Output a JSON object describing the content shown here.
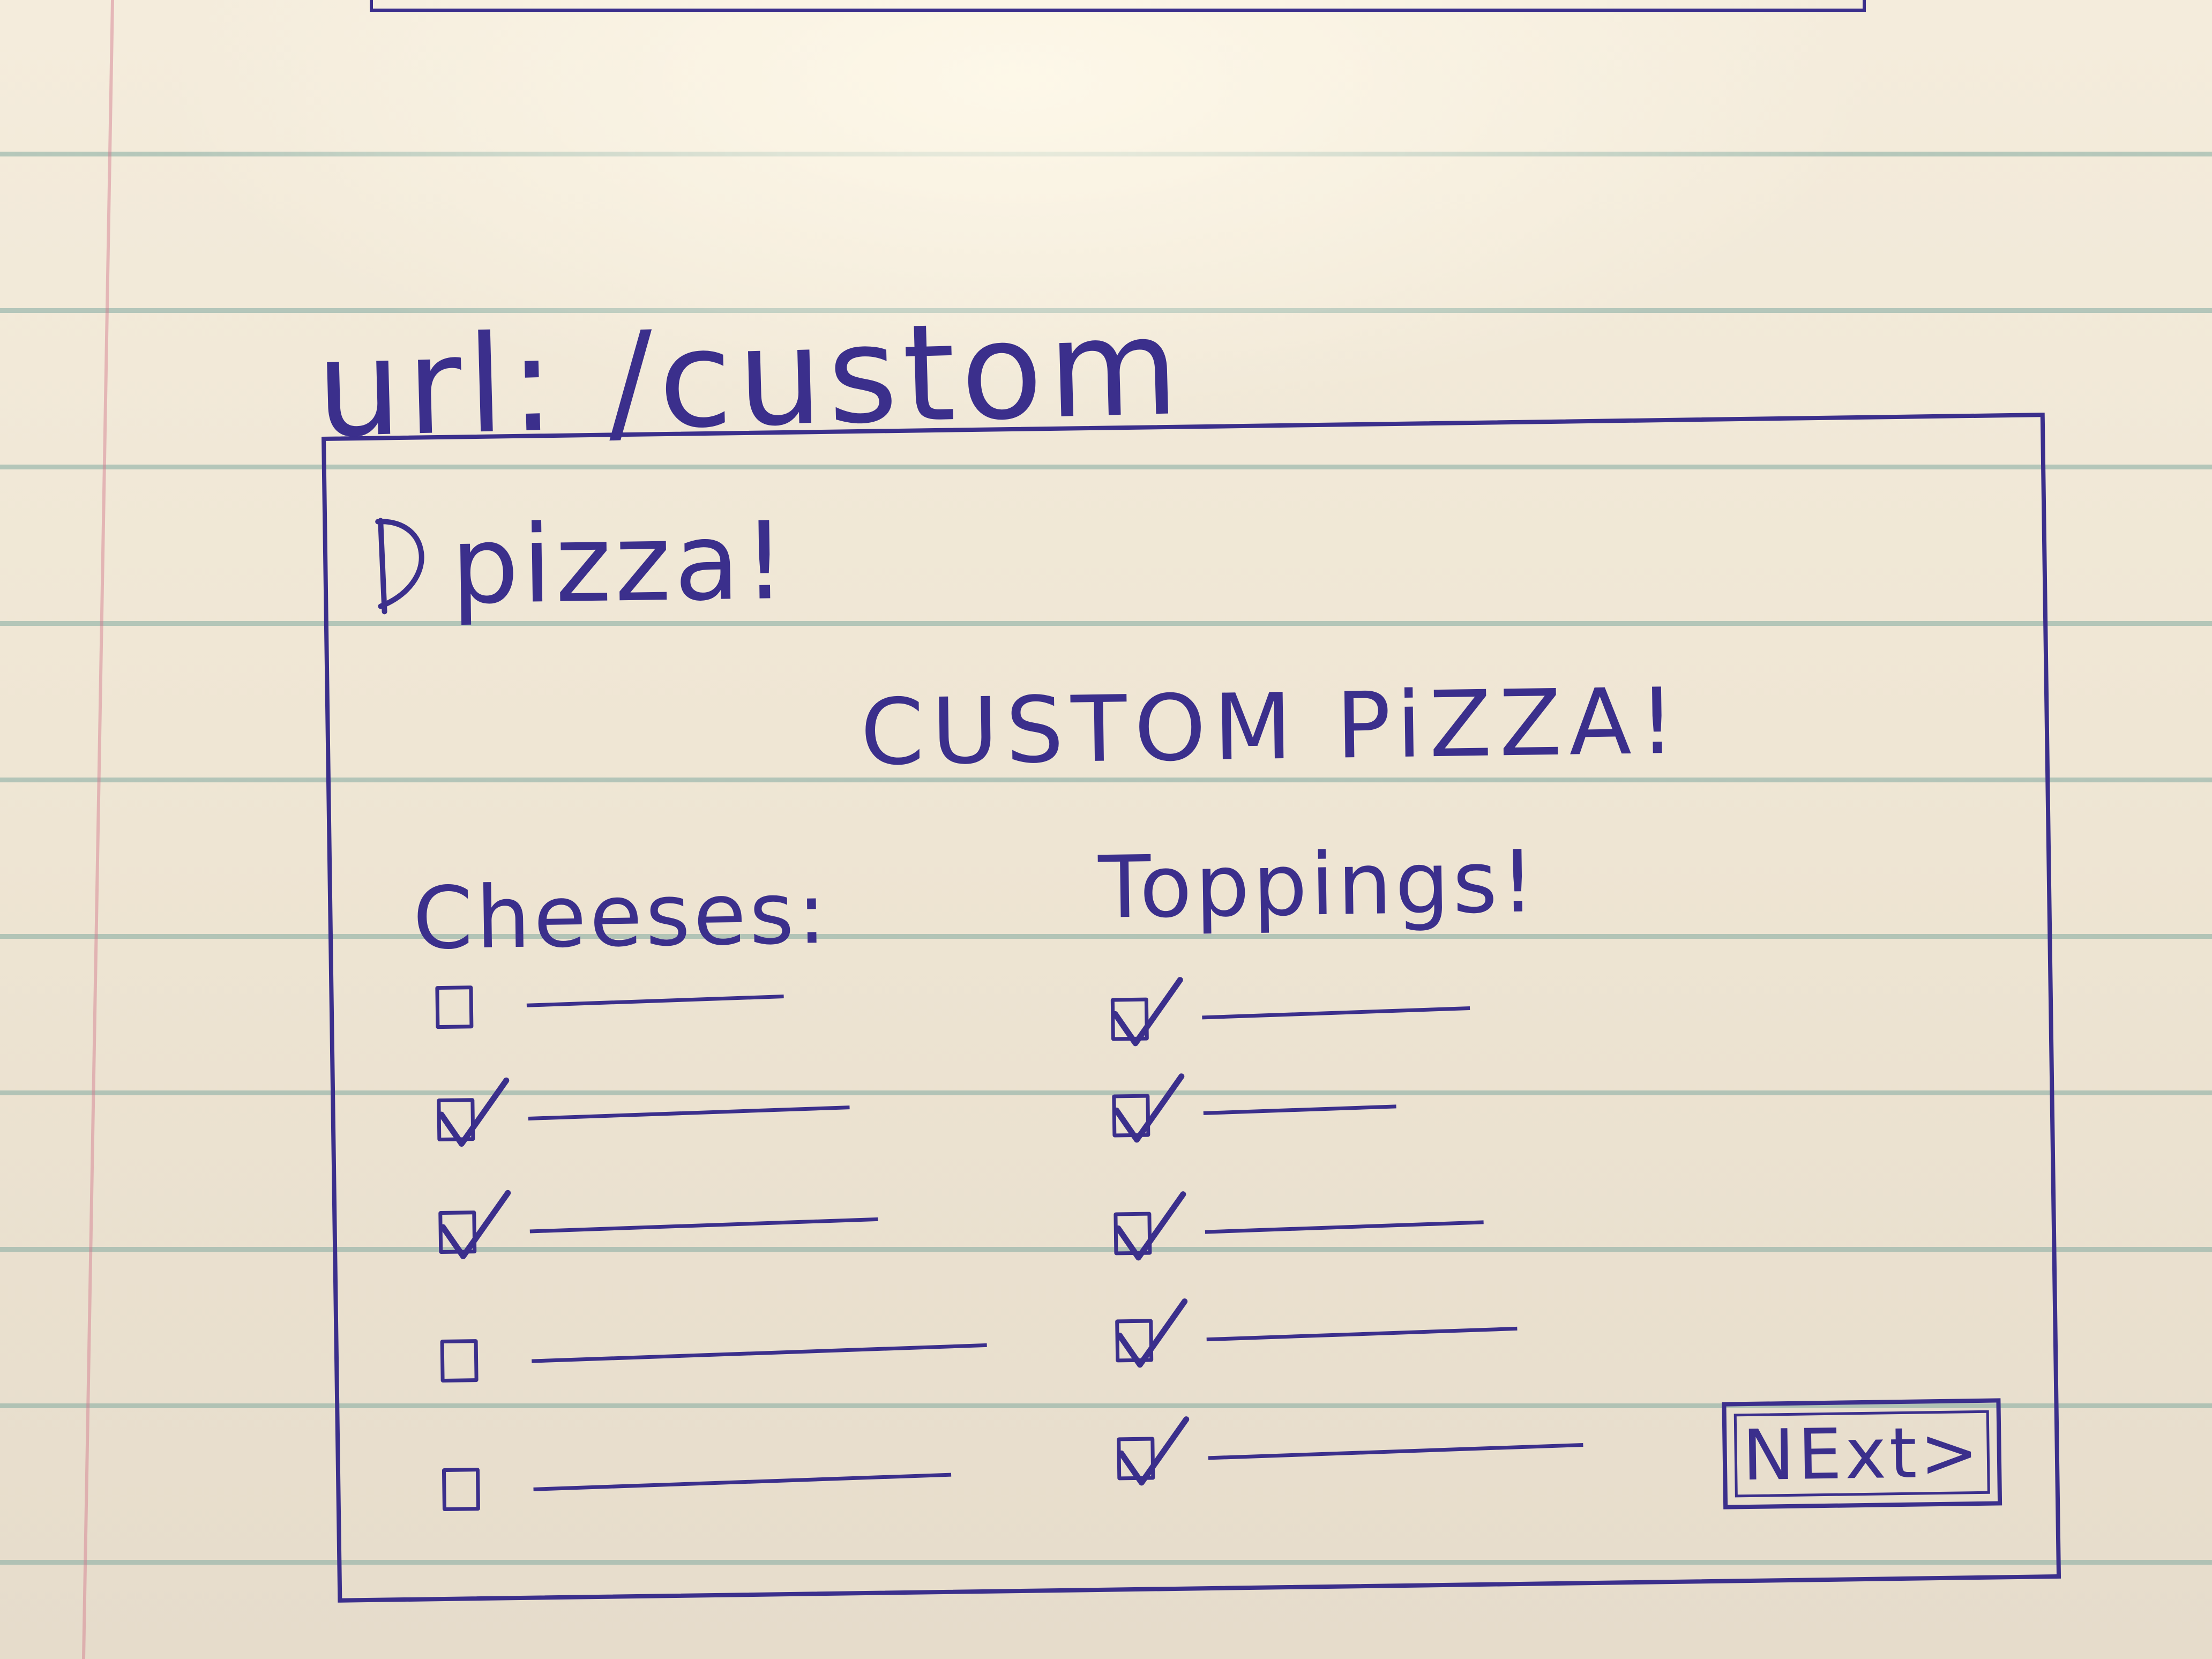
{
  "sketch": {
    "url_label": "url: /custom",
    "brand": "pizza!",
    "title": "CUSTOM PiZZA!",
    "cheeses": {
      "label": "Cheeses:",
      "options": [
        {
          "checked": false
        },
        {
          "checked": true
        },
        {
          "checked": true
        },
        {
          "checked": false
        },
        {
          "checked": false
        }
      ]
    },
    "toppings": {
      "label": "Toppings!",
      "options": [
        {
          "checked": true
        },
        {
          "checked": true
        },
        {
          "checked": true
        },
        {
          "checked": true
        },
        {
          "checked": true
        }
      ]
    },
    "next_button": "NExt>"
  }
}
